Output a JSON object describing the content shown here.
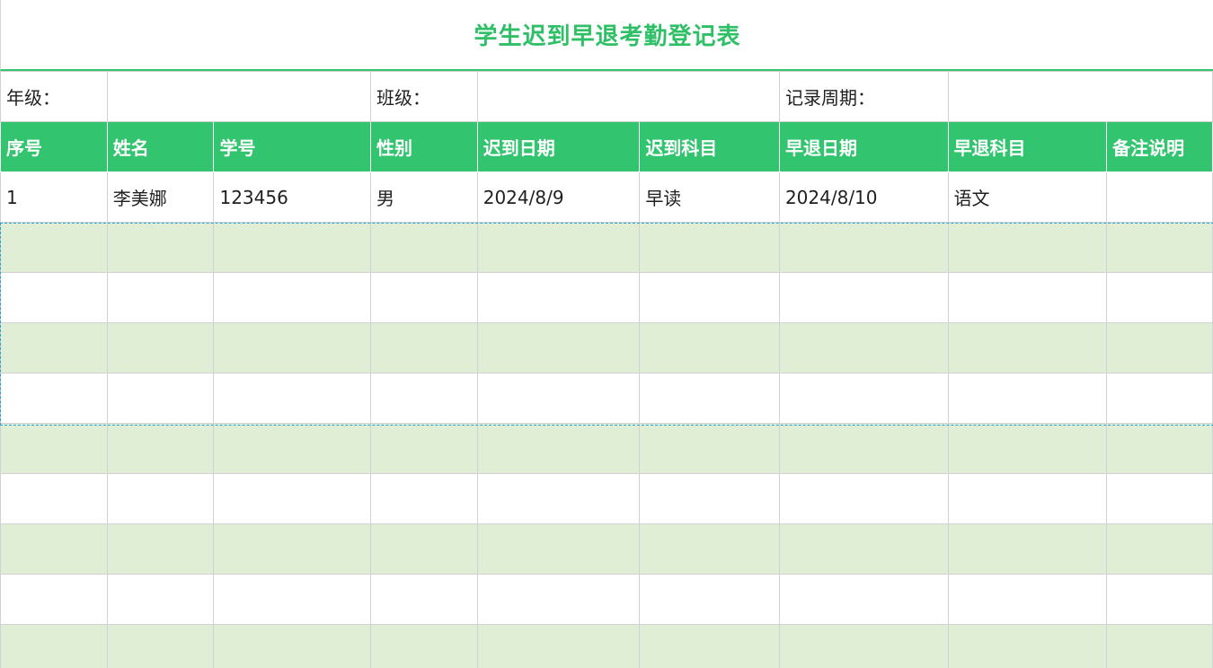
{
  "title": "学生迟到早退考勤登记表",
  "info": {
    "grade_label": "年级：",
    "class_label": "班级：",
    "period_label": "记录周期：",
    "grade_value": "",
    "class_value": "",
    "period_value": ""
  },
  "columns": [
    "序号",
    "姓名",
    "学号",
    "性别",
    "迟到日期",
    "迟到科目",
    "早退日期",
    "早退科目",
    "备注说明"
  ],
  "rows": [
    [
      "1",
      "李美娜",
      "123456",
      "男",
      "2024/8/9",
      "早读",
      "2024/8/10",
      "语文",
      ""
    ],
    [
      "",
      "",
      "",
      "",
      "",
      "",
      "",
      "",
      ""
    ],
    [
      "",
      "",
      "",
      "",
      "",
      "",
      "",
      "",
      ""
    ],
    [
      "",
      "",
      "",
      "",
      "",
      "",
      "",
      "",
      ""
    ],
    [
      "",
      "",
      "",
      "",
      "",
      "",
      "",
      "",
      ""
    ],
    [
      "",
      "",
      "",
      "",
      "",
      "",
      "",
      "",
      ""
    ],
    [
      "",
      "",
      "",
      "",
      "",
      "",
      "",
      "",
      ""
    ],
    [
      "",
      "",
      "",
      "",
      "",
      "",
      "",
      "",
      ""
    ],
    [
      "",
      "",
      "",
      "",
      "",
      "",
      "",
      "",
      ""
    ],
    [
      "",
      "",
      "",
      "",
      "",
      "",
      "",
      "",
      ""
    ]
  ],
  "colors": {
    "accent": "#33c46f",
    "title": "#2fbf66",
    "stripe": "#e1eed6",
    "selection": "#2a9fd8"
  }
}
